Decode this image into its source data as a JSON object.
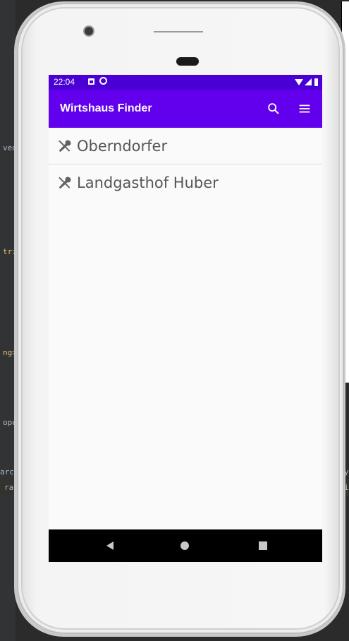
{
  "background": {
    "code_fragments": [
      "ved",
      "tri",
      "ng>",
      "ope",
      "arch",
      "ra",
      ",",
      "y",
      "i"
    ]
  },
  "status_bar": {
    "time": "22:04",
    "icons": [
      "notification-icon",
      "sync-icon",
      "wifi-icon",
      "signal-icon",
      "battery-icon"
    ]
  },
  "app_bar": {
    "title": "Wirtshaus Finder",
    "actions": [
      "search-icon",
      "menu-icon"
    ],
    "color": "#6200ee",
    "status_color": "#4a00d4"
  },
  "list": {
    "items": [
      {
        "label": "Oberndorfer",
        "icon": "restaurant-icon"
      },
      {
        "label": "Landgasthof Huber",
        "icon": "restaurant-icon"
      }
    ]
  },
  "nav_bar": {
    "buttons": [
      "back-icon",
      "home-icon",
      "recents-icon"
    ]
  }
}
